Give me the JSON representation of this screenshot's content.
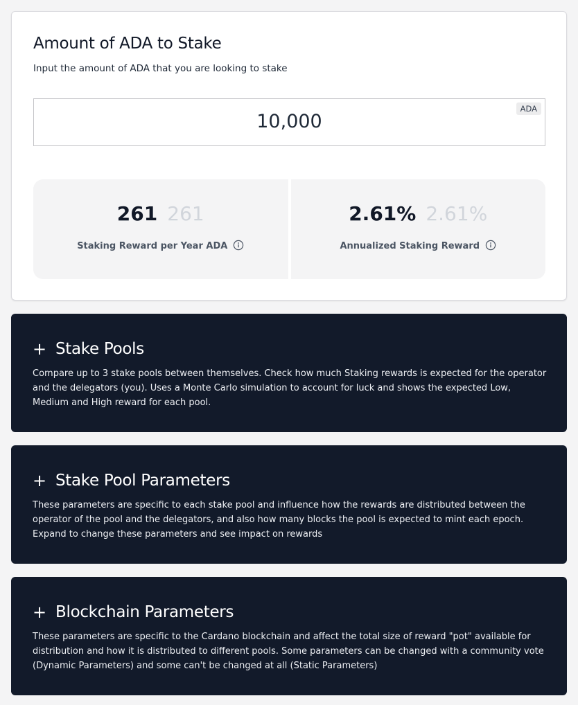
{
  "stake": {
    "title": "Amount of ADA to Stake",
    "subtitle": "Input the amount of ADA that you are looking to stake",
    "amount_value": "10,000",
    "unit": "ADA"
  },
  "stats": [
    {
      "value": "261",
      "ghost_value": "261",
      "label": "Staking Reward per Year ADA",
      "icon": "info-icon"
    },
    {
      "value": "2.61%",
      "ghost_value": "2.61%",
      "label": "Annualized Staking Reward",
      "icon": "info-icon"
    }
  ],
  "panels": [
    {
      "icon": "plus-icon",
      "expand_symbol": "+",
      "title": "Stake Pools",
      "description": "Compare up to 3 stake pools between themselves. Check how much Staking rewards is expected for the operator and the delegators (you). Uses a Monte Carlo simulation to account for luck and shows the expected Low, Medium and High reward for each pool."
    },
    {
      "icon": "plus-icon",
      "expand_symbol": "+",
      "title": "Stake Pool Parameters",
      "description": "These parameters are specific to each stake pool and influence how the rewards are distributed between the operator of the pool and the delegators, and also how many blocks the pool is expected to mint each epoch. Expand to change these parameters and see impact on rewards"
    },
    {
      "icon": "plus-icon",
      "expand_symbol": "+",
      "title": "Blockchain Parameters",
      "description": "These parameters are specific to the Cardano blockchain and affect the total size of reward \"pot\" available for distribution and how it is distributed to different pools. Some parameters can be changed with a community vote (Dynamic Parameters) and some can't be changed at all (Static Parameters)"
    }
  ],
  "colors": {
    "panel_bg": "#121a2a",
    "card_bg": "#ffffff",
    "stat_bg": "#f4f4f5",
    "ghost_text": "#d1d5db"
  }
}
